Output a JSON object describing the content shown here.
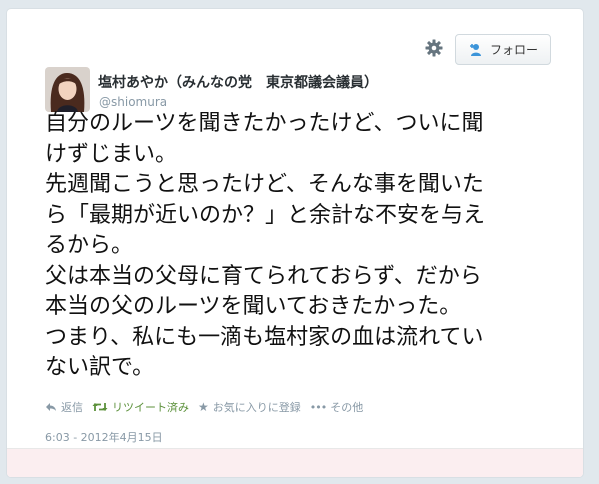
{
  "header": {
    "follow_label": "フォロー"
  },
  "user": {
    "display_name": "塩村あやか（みんなの党　東京都議会議員）",
    "handle": "@shiomura"
  },
  "tweet": {
    "lines": [
      "自分のルーツを聞きたかったけど、ついに聞",
      "けずじまい。",
      "先週聞こうと思ったけど、そんな事を聞いた",
      "ら「最期が近いのか？」と余計な不安を与え",
      "るから。",
      "父は本当の父母に育てられておらず、だから",
      "本当の父のルーツを聞いておきたかった。",
      "つまり、私にも一滴も塩村家の血は流れてい",
      "ない訳で。"
    ],
    "timestamp": "6:03 - 2012年4月15日"
  },
  "actions": {
    "reply": "返信",
    "retweet": "リツイート済み",
    "favorite": "お気に入りに登録",
    "more": "その他"
  },
  "colors": {
    "background": "#e1e8ed",
    "meta_text": "#8899a6",
    "retweet_active": "#5c913b",
    "footer": "#fbeef0"
  }
}
